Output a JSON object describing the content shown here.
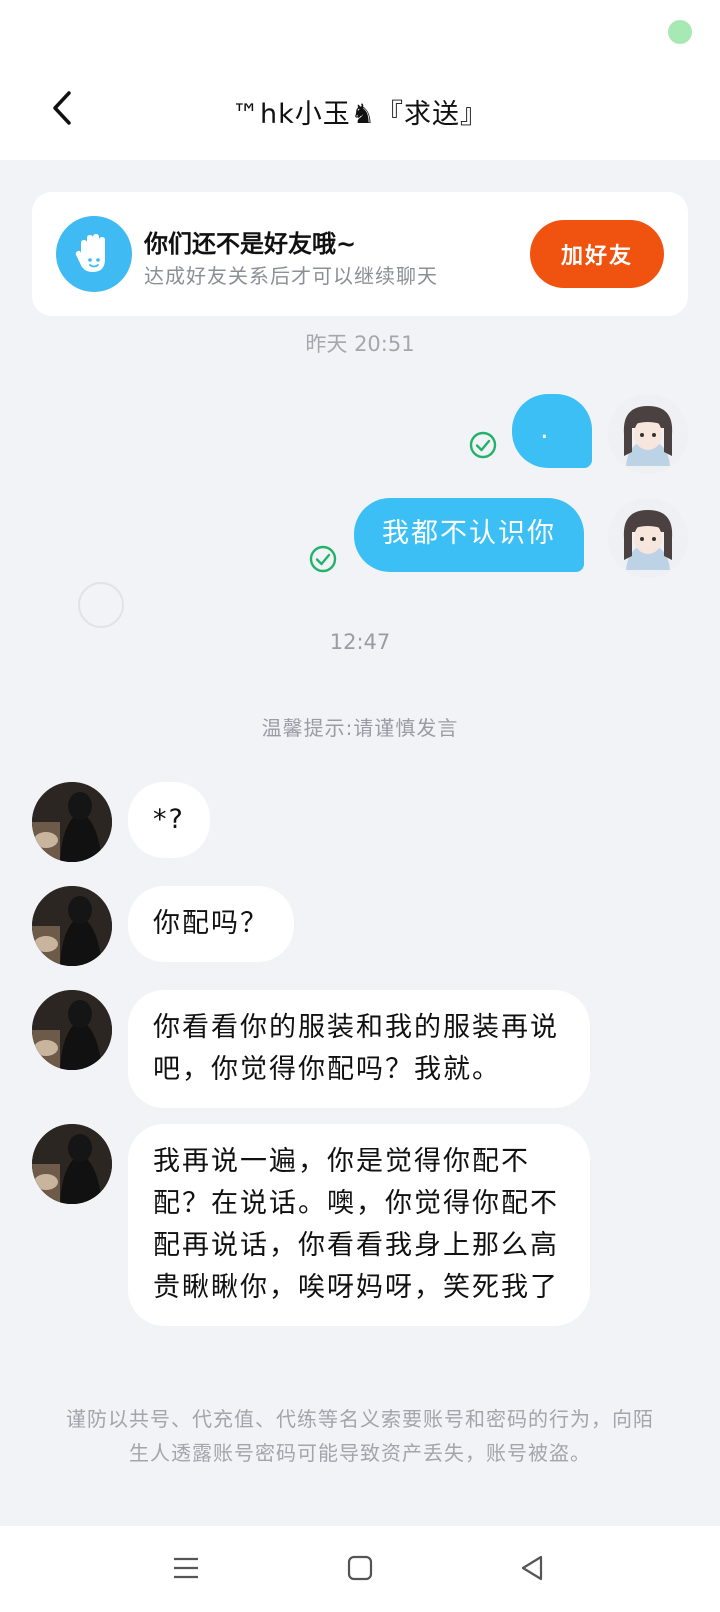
{
  "header": {
    "title": "™hk小玉♞『求送』",
    "back_icon": "chevron-left-icon"
  },
  "friend_card": {
    "icon": "waving-hand-icon",
    "title": "你们还不是好友哦~",
    "subtitle": "达成好友关系后才可以继续聊天",
    "add_button": "加好友"
  },
  "times": {
    "partial": "昨天 20:51",
    "second": "12:47"
  },
  "tip": "温馨提示:请谨慎发言",
  "outgoing": [
    {
      "text": ".",
      "status": "check-circle-icon"
    },
    {
      "text": "我都不认识你",
      "status": "check-circle-icon"
    }
  ],
  "incoming": [
    {
      "text": "*?"
    },
    {
      "text": "你配吗？"
    },
    {
      "text": "你看看你的服装和我的服装再说吧，你觉得你配吗？我就。"
    },
    {
      "text": "我再说一遍，你是觉得你配不配？在说话。噢，你觉得你配不配再说话，你看看我身上那么高贵瞅瞅你，唉呀妈呀，笑死我了"
    }
  ],
  "notice": "谨防以共号、代充值、代练等名义索要账号和密码的行为，向陌生人透露账号密码可能导致资产丢失，账号被盗。",
  "colors": {
    "accent": "#3cbff5",
    "add_button": "#f0520f",
    "check": "#21b36a",
    "background": "#f2f3f7"
  },
  "navbar": {
    "icons": [
      "menu-icon",
      "home-square-icon",
      "back-triangle-icon"
    ]
  }
}
